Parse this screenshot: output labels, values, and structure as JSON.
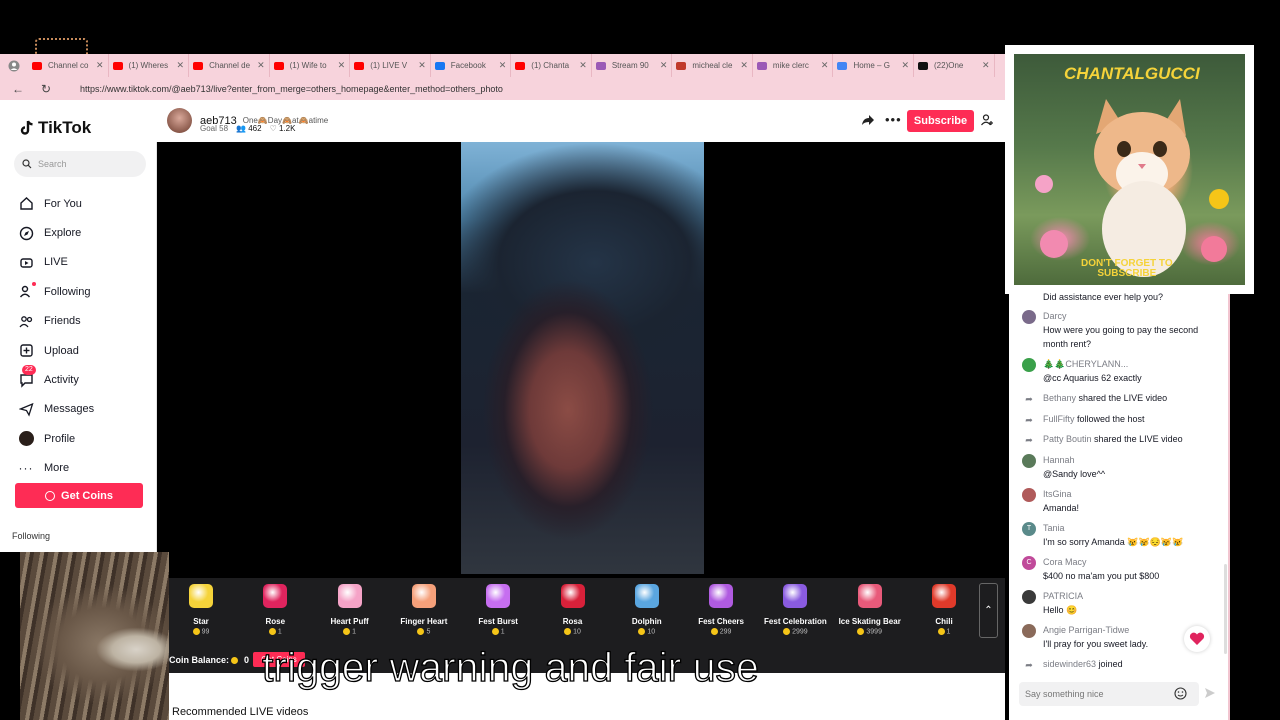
{
  "browser": {
    "tabs": [
      {
        "label": "Channel co",
        "color": "#ff0000"
      },
      {
        "label": "(1) Wheres",
        "color": "#ff0000"
      },
      {
        "label": "Channel de",
        "color": "#ff0000"
      },
      {
        "label": "(1) Wife to",
        "color": "#ff0000"
      },
      {
        "label": "(1) LIVE V",
        "color": "#ff0000"
      },
      {
        "label": "Facebook",
        "color": "#1877f2"
      },
      {
        "label": "(1) Chanta",
        "color": "#ff0000"
      },
      {
        "label": "Stream 90",
        "color": "#9b59b6"
      },
      {
        "label": "micheal cle",
        "color": "#c0392b"
      },
      {
        "label": "mike clerc",
        "color": "#9b59b6"
      },
      {
        "label": "Home – G",
        "color": "#4285f4"
      },
      {
        "label": "(22)One",
        "color": "#111111"
      }
    ],
    "url": "https://www.tiktok.com/@aeb713/live?enter_from_merge=others_homepage&enter_method=others_photo"
  },
  "sidebar": {
    "logo": "TikTok",
    "search_placeholder": "Search",
    "items": [
      {
        "label": "For You",
        "icon": "home-icon"
      },
      {
        "label": "Explore",
        "icon": "compass-icon"
      },
      {
        "label": "LIVE",
        "icon": "live-icon"
      },
      {
        "label": "Following",
        "icon": "following-icon"
      },
      {
        "label": "Friends",
        "icon": "friends-icon"
      },
      {
        "label": "Upload",
        "icon": "upload-icon"
      },
      {
        "label": "Activity",
        "icon": "activity-icon",
        "badge": "22"
      },
      {
        "label": "Messages",
        "icon": "messages-icon"
      },
      {
        "label": "Profile",
        "icon": "avatar"
      },
      {
        "label": "More",
        "icon": "more-icon"
      }
    ],
    "get_coins": "Get Coins",
    "following_header": "Following"
  },
  "host": {
    "name": "aeb713",
    "bio": "One🙈Day🙈at🙈atime",
    "goal": "Goal 58",
    "viewers": "462",
    "likes": "1.2K",
    "subscribe": "Subscribe"
  },
  "gifts": [
    {
      "name": "Star",
      "price": "99",
      "color": "#f5d33a"
    },
    {
      "name": "Rose",
      "price": "1",
      "color": "#e0245e"
    },
    {
      "name": "Heart Puff",
      "price": "1",
      "color": "#f5a3c7"
    },
    {
      "name": "Finger Heart",
      "price": "5",
      "color": "#f5a07a"
    },
    {
      "name": "Fest Burst",
      "price": "1",
      "color": "#c66ef0"
    },
    {
      "name": "Rosa",
      "price": "10",
      "color": "#d8213a"
    },
    {
      "name": "Dolphin",
      "price": "10",
      "color": "#5aa6e0"
    },
    {
      "name": "Fest Cheers",
      "price": "299",
      "color": "#b05be0"
    },
    {
      "name": "Fest Celebration",
      "price": "2999",
      "color": "#8a5be0"
    },
    {
      "name": "Ice Skating Bear",
      "price": "3999",
      "color": "#e85a7a"
    },
    {
      "name": "Chili",
      "price": "1",
      "color": "#e03a2a"
    }
  ],
  "coin_balance": {
    "label": "Coin Balance:",
    "value": "0",
    "button": "Get Coins"
  },
  "recommended": "Recommended LIVE videos",
  "overlay_caption": "trigger warning and fair use",
  "cat_ad": {
    "title": "CHANTALGUCCI",
    "cta_line1": "DON'T FORGET TO",
    "cta_line2": "SUBSCRIBE"
  },
  "chat": {
    "messages": [
      {
        "name": "",
        "text": "Did assistance ever help you?",
        "avatar": "#999999"
      },
      {
        "name": "Darcy",
        "text": "How were you going to pay the second month rent?",
        "avatar": "#7a6a8a"
      },
      {
        "name": "🎄🎄CHERYLANN...",
        "text": "@cc Aquarius 62 exactly",
        "avatar": "#3aa04a"
      },
      {
        "name": "Bethany",
        "text": "shared the LIVE video",
        "system": true
      },
      {
        "name": "FullFifty",
        "text": "followed the host",
        "system": true
      },
      {
        "name": "Patty Boutin",
        "text": "shared the LIVE video",
        "system": true
      },
      {
        "name": "Hannah",
        "text": "@Sandy love^^",
        "avatar": "#5a7a5a"
      },
      {
        "name": "ItsGina",
        "text": "Amanda!",
        "avatar": "#b05a5a"
      },
      {
        "name": "Tania",
        "text": "I'm so sorry Amanda 😿😿😔😿😿",
        "avatar": "#5a8a8a",
        "initial": "T"
      },
      {
        "name": "Cora Macy",
        "text": "$400 no ma'am you put $800",
        "avatar": "#c04a9a",
        "initial": "C"
      },
      {
        "name": "PATRICIA",
        "text": "Hello 😊",
        "avatar": "#3a3a3a"
      },
      {
        "name": "Angie Parrigan-Tidwe",
        "text": "I'll pray for you sweet lady.",
        "avatar": "#8a6a5a"
      },
      {
        "name": "sidewinder63",
        "text": "joined",
        "system": true
      }
    ],
    "input_placeholder": "Say something nice"
  }
}
